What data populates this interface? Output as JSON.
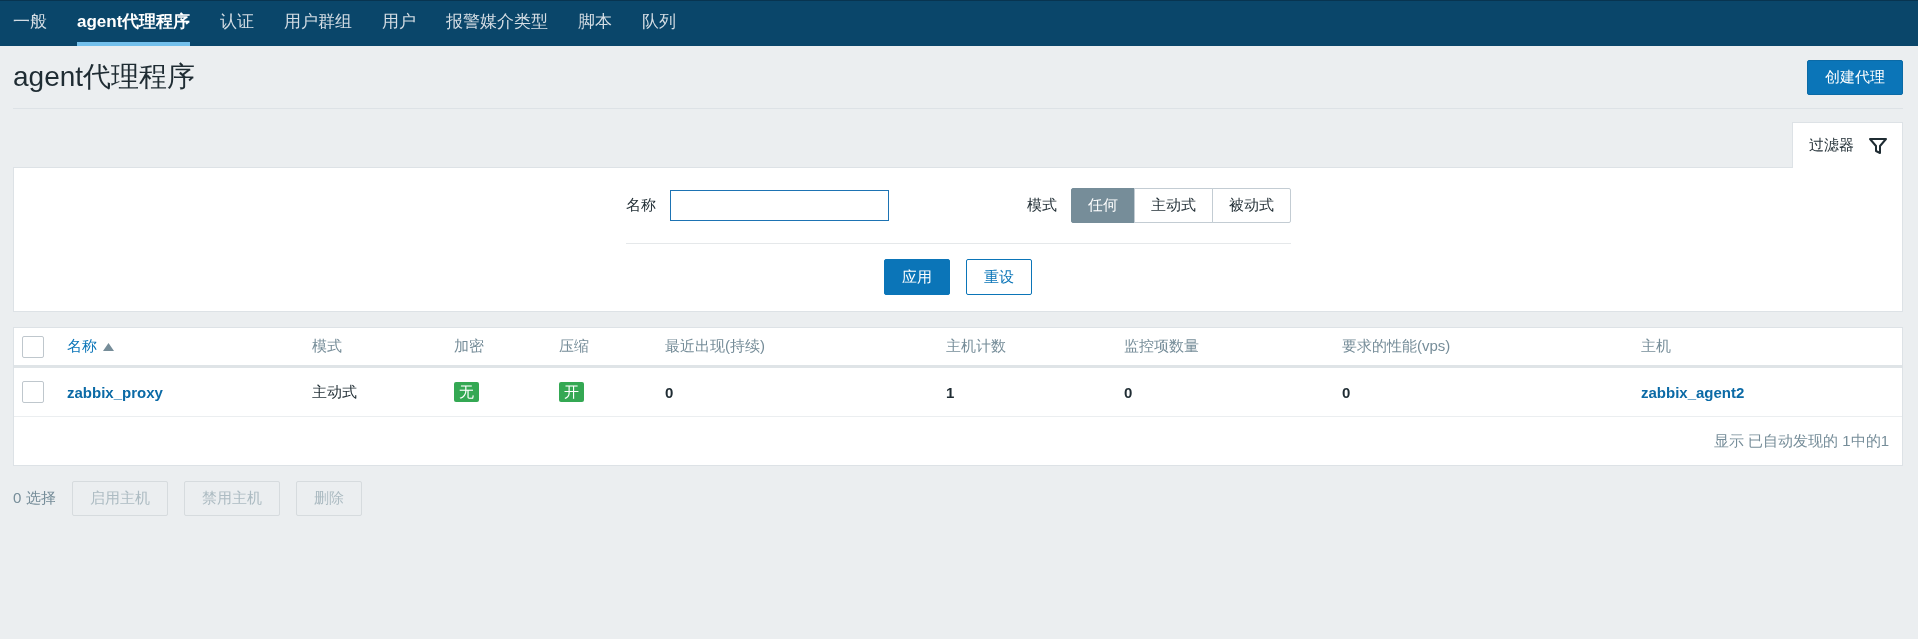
{
  "nav": {
    "tabs": [
      {
        "label": "一般",
        "selected": false
      },
      {
        "label": "agent代理程序",
        "selected": true
      },
      {
        "label": "认证",
        "selected": false
      },
      {
        "label": "用户群组",
        "selected": false
      },
      {
        "label": "用户",
        "selected": false
      },
      {
        "label": "报警媒介类型",
        "selected": false
      },
      {
        "label": "脚本",
        "selected": false
      },
      {
        "label": "队列",
        "selected": false
      }
    ]
  },
  "page": {
    "title": "agent代理程序",
    "create_button": "创建代理"
  },
  "filter": {
    "tab_label": "过滤器",
    "name_label": "名称",
    "mode_label": "模式",
    "mode_options": [
      {
        "label": "任何",
        "selected": true
      },
      {
        "label": "主动式",
        "selected": false
      },
      {
        "label": "被动式",
        "selected": false
      }
    ],
    "apply_button": "应用",
    "reset_button": "重设"
  },
  "table": {
    "select_all_checked": false,
    "columns": [
      {
        "label": "名称",
        "sorted": true
      },
      {
        "label": "模式",
        "sorted": false
      },
      {
        "label": "加密",
        "sorted": false
      },
      {
        "label": "压缩",
        "sorted": false
      },
      {
        "label": "最近出现(持续)",
        "sorted": false
      },
      {
        "label": "主机计数",
        "sorted": false
      },
      {
        "label": "监控项数量",
        "sorted": false
      },
      {
        "label": "要求的性能(vps)",
        "sorted": false
      },
      {
        "label": "主机",
        "sorted": false
      }
    ],
    "rows": [
      {
        "checked": false,
        "cells": [
          {
            "kind": "link",
            "text": "zabbix_proxy"
          },
          {
            "kind": "text",
            "text": "主动式"
          },
          {
            "kind": "badge",
            "text": "无",
            "color": "#34a853"
          },
          {
            "kind": "badge",
            "text": "开",
            "color": "#34a853"
          },
          {
            "kind": "value",
            "text": "0"
          },
          {
            "kind": "value",
            "text": "1"
          },
          {
            "kind": "value",
            "text": "0"
          },
          {
            "kind": "value",
            "text": "0"
          },
          {
            "kind": "link",
            "text": "zabbix_agent2"
          }
        ]
      }
    ],
    "footer": "显示 已自动发现的 1中的1"
  },
  "actions": {
    "selected_count": "0 选择",
    "buttons": [
      {
        "label": "启用主机",
        "disabled": true
      },
      {
        "label": "禁用主机",
        "disabled": true
      },
      {
        "label": "删除",
        "disabled": true
      }
    ]
  }
}
